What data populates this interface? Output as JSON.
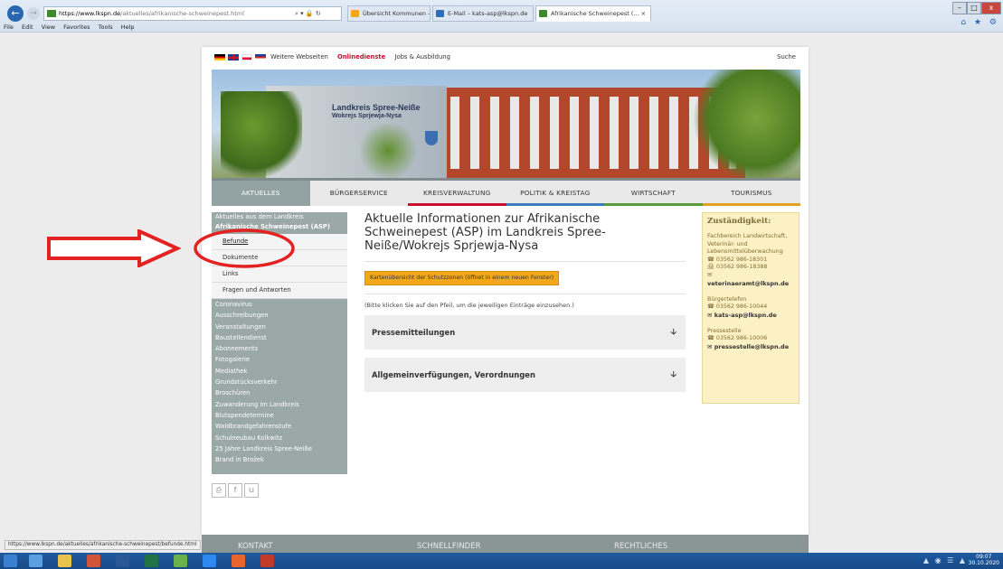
{
  "browser": {
    "url": "https://www.lkspn.de/aktuelles/afrikanische-schweinepest.html",
    "url_domain": "https://www.lkspn.de",
    "url_path": "/aktuelles/afrikanische-schweinepest.html",
    "addr_tools": "⌕ ▾ 🔒 ↻",
    "tabs": [
      {
        "label": "Übersicht Kommunen - Intran..."
      },
      {
        "label": "E-Mail – kats-asp@lkspn.de"
      },
      {
        "label": "Afrikanische Schweinepest (... ×"
      }
    ],
    "menu": [
      "File",
      "Edit",
      "View",
      "Favorites",
      "Tools",
      "Help"
    ],
    "window_buttons": [
      "–",
      "□",
      "x"
    ],
    "top_icons": "⌂ ★ ⚙",
    "status_url": "https://www.lkspn.de/aktuelles/afrikanische-schweinepest/befunde.html"
  },
  "topnav": {
    "links": [
      "Weitere Webseiten",
      "Onlinedienste",
      "Jobs & Ausbildung"
    ],
    "search": "Suche"
  },
  "banner": {
    "sign_line1": "Landkreis Spree-Neiße",
    "sign_line2": "Wokrejs Sprjewja-Nysa"
  },
  "mainnav": [
    "AKTUELLES",
    "BÜRGERSERVICE",
    "KREISVERWALTUNG",
    "POLITIK & KREISTAG",
    "WIRTSCHAFT",
    "TOURISMUS"
  ],
  "sidebar": {
    "top": "Aktuelles aus dem Landkreis",
    "section": "Afrikanische Schweinepest (ASP)",
    "sub": [
      "Befunde",
      "Dokumente",
      "Links",
      "Fragen und Antworten"
    ],
    "items": [
      "Coronavirus",
      "Ausschreibungen",
      "Veranstaltungen",
      "Baustellendienst",
      "Abonnements",
      "Fotogalerie",
      "Mediathek",
      "Grundstücksverkehr",
      "Broschüren",
      "Zuwanderung im Landkreis",
      "Blutspendetermine",
      "Waldbrandgefahrenstufe",
      "Schulneubau Kolkwitz",
      "25 Jahre Landkreis Spree-Neiße",
      "Brand in Brožek"
    ]
  },
  "content": {
    "title": "Aktuelle Informationen zur Afrikanische Schweinepest (ASP) im Landkreis Spree-Neiße/Wokrejs Sprjewja-Nysa",
    "map_button": "Kartenübersicht der Schutzzonen (öffnet in einem neuen Fenster)",
    "hint": "(Bitte klicken Sie auf den Pfeil, um die jeweiligen Einträge einzusehen.)",
    "accordions": [
      "Pressemitteilungen",
      "Allgemeinverfügungen, Verordnungen"
    ]
  },
  "infobox": {
    "heading": "Zuständigkeit:",
    "dept": "Fachbereich Landwirtschaft, Veterinär- und Lebensmittelüberwachung",
    "tel": "☎ 03562 986-18301",
    "fax": "🖨 03562 986-18388",
    "email_icon": "✉",
    "email": "veterinaeramt@lkspn.de",
    "buergertel_label": "Bürgertelefon",
    "buergertel_tel": "☎ 03562 986-10044",
    "buergertel_email": "✉ kats-asp@lkspn.de",
    "presse_label": "Pressestelle",
    "presse_tel": "☎ 03562 986-10006",
    "presse_email": "✉ pressestelle@lkspn.de"
  },
  "footer": [
    "KONTAKT",
    "SCHNELLFINDER",
    "RECHTLICHES"
  ],
  "taskbar": {
    "time": "09:07",
    "date": "30.10.2020"
  },
  "colors": {
    "accent_red": "#c8102e",
    "nav_active": "#93a3a3",
    "sidebar": "#9aa8a6",
    "button_orange": "#f2a81b",
    "infobox_bg": "#fcf1c4",
    "annotation_red": "#e32222"
  }
}
